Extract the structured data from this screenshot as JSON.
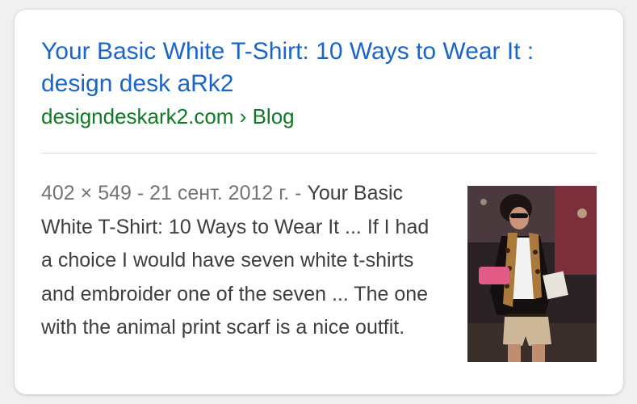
{
  "result": {
    "title": "Your Basic White T-Shirt: 10 Ways to Wear It : design desk aRk2",
    "site": "designdeskark2.com",
    "breadcrumb_sep": " › ",
    "path": "Blog",
    "image_meta": "402 × 549 - 21 сент. 2012 г. - ",
    "snippet": "Your Basic White T-Shirt: 10 Ways to Wear It ... If I had a choice I would have seven white t-shirts and embroider one of the seven ... The one with the animal print scarf is a nice outfit."
  },
  "colors": {
    "title": "#1a65c9",
    "url": "#0e7a25",
    "meta": "#70757a",
    "text": "#3c4043"
  }
}
